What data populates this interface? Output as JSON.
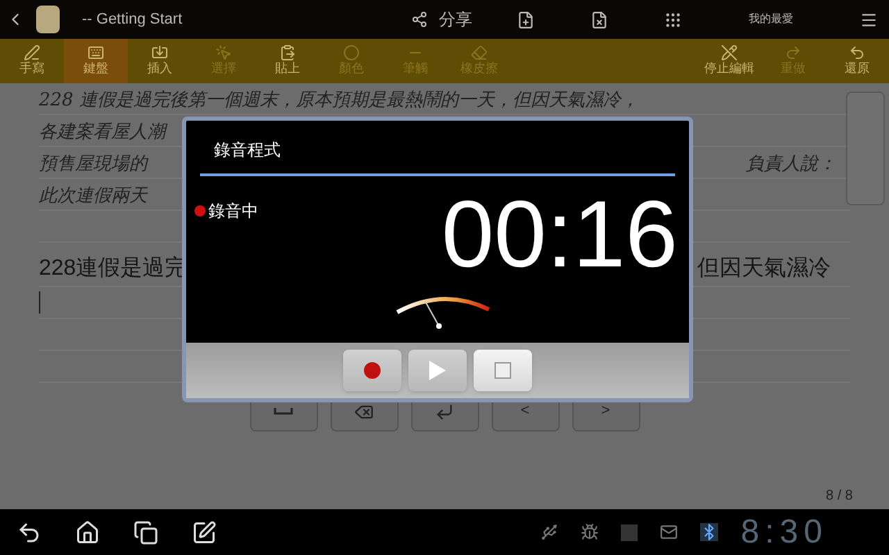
{
  "top_bar": {
    "title": "-- Getting Start",
    "share": "分享",
    "favorites": "我的最愛"
  },
  "toolbar": {
    "left": [
      {
        "label": "手寫",
        "selected": false,
        "disabled": false
      },
      {
        "label": "鍵盤",
        "selected": true,
        "disabled": false
      },
      {
        "label": "插入",
        "selected": false,
        "disabled": false
      },
      {
        "label": "選擇",
        "selected": false,
        "disabled": true
      },
      {
        "label": "貼上",
        "selected": false,
        "disabled": false
      },
      {
        "label": "顏色",
        "selected": false,
        "disabled": true
      },
      {
        "label": "筆觸",
        "selected": false,
        "disabled": true
      },
      {
        "label": "橡皮擦",
        "selected": false,
        "disabled": true
      }
    ],
    "right": [
      {
        "label": "停止編輯",
        "selected": false,
        "disabled": false
      },
      {
        "label": "重做",
        "selected": false,
        "disabled": true
      },
      {
        "label": "還原",
        "selected": false,
        "disabled": false
      }
    ]
  },
  "note": {
    "handwriting": [
      {
        "left": "228 連假是過完後第一個週末，原本預期是最熱鬧的一天，但因天氣濕冷，"
      },
      {
        "left": "各建案看屋人潮"
      },
      {
        "left": "預售屋現場的",
        "right": "負責人說："
      },
      {
        "left": "此次連假兩天"
      }
    ],
    "typed": {
      "left": "228連假是過完",
      "right": "但因天氣濕冷"
    },
    "keys": [
      {
        "kind": "space"
      },
      {
        "kind": "backspace"
      },
      {
        "kind": "enter"
      },
      {
        "kind": "text",
        "label": "<"
      },
      {
        "kind": "text",
        "label": ">"
      }
    ],
    "page": "8 / 8"
  },
  "dialog": {
    "title": "錄音程式",
    "status": "錄音中",
    "time": "00:16",
    "buttons": [
      {
        "kind": "record",
        "selected": false
      },
      {
        "kind": "play",
        "selected": false
      },
      {
        "kind": "stop",
        "selected": true
      }
    ]
  },
  "nav_bar": {
    "clock": "8:30"
  }
}
